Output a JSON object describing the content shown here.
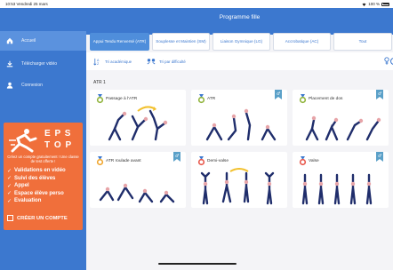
{
  "status_bar": {
    "time": "10:53",
    "date": "Vendredi 25 mars",
    "battery": "100 %"
  },
  "header": {
    "title": "Programme fille"
  },
  "sidebar": {
    "items": [
      {
        "label": "Accueil",
        "icon": "home-icon",
        "active": true
      },
      {
        "label": "Télécharger vidéo",
        "icon": "download-icon",
        "active": false
      },
      {
        "label": "Connexion",
        "icon": "user-icon",
        "active": false
      }
    ]
  },
  "promo": {
    "brand_line1": "E P S",
    "brand_line2": "T O P",
    "text": "Créez un compte gratuitement ! Une classe de test offerte !",
    "features": [
      "Validations en vidéo",
      "Suivi des élèves",
      "Appel",
      "Espace élève perso",
      "Evaluation"
    ],
    "cta": "CRÉER UN COMPTE"
  },
  "tabs": [
    {
      "label": "Appui Tendu Renversé (ATR)",
      "active": true
    },
    {
      "label": "Souplesse et Maintien (SM)",
      "active": false
    },
    {
      "label": "Liaison Gymnique (LG)",
      "active": false
    },
    {
      "label": "Accrobatique (AC)",
      "active": false
    },
    {
      "label": "Tout",
      "active": false
    }
  ],
  "sort": {
    "academic": "Tri académique",
    "difficulty": "Tri par difficulté"
  },
  "section": {
    "label": "ATR 1"
  },
  "cards": [
    {
      "title": "Passage à l'ATR",
      "medal_color": "#8fb33a",
      "bookmark": false
    },
    {
      "title": "ATR",
      "medal_color": "#8fb33a",
      "bookmark": true
    },
    {
      "title": "Placement de dos",
      "medal_color": "#8fb33a",
      "bookmark": true
    },
    {
      "title": "ATR roulade avant",
      "medal_color": "#f0a52c",
      "bookmark": true
    },
    {
      "title": "Demi-valse",
      "medal_color": "#e8564a",
      "bookmark": false
    },
    {
      "title": "Valse",
      "medal_color": "#e8564a",
      "bookmark": true
    }
  ],
  "colors": {
    "primary": "#3c78cf",
    "promo": "#f06f3b",
    "bookmark": "#5aa0c8",
    "background": "#f4f4f7"
  }
}
